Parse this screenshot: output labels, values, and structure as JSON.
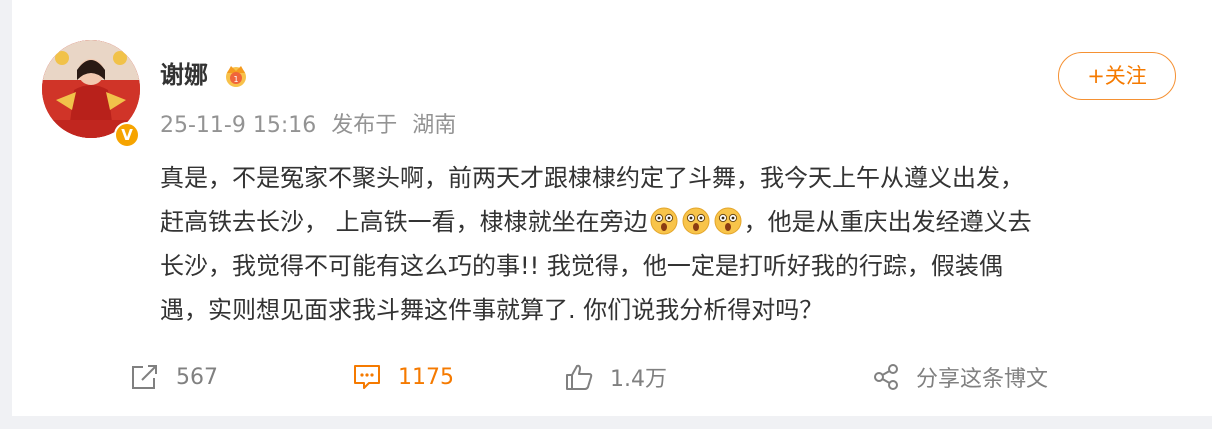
{
  "post": {
    "author": "谢娜",
    "timestamp": "25-11-9 15:16",
    "publish_location_prefix": "发布于",
    "location": "湖南",
    "follow_label": "+关注",
    "content_lines": [
      "真是，不是冤家不聚头啊，前两天才跟棣棣约定了斗舞，我今天上午从遵义出发，",
      "赶高铁去长沙， 上高铁一看，棣棣就坐在旁边",
      "，他是从重庆出发经遵义去",
      "长沙，我觉得不可能有这么巧的事!! 我觉得，他一定是打听好我的行踪，假装偶",
      "遇，实则想见面求我斗舞这件事就算了. 你们说我分析得对吗？"
    ],
    "emoji_icons": [
      "surprised-face-icon",
      "surprised-face-icon",
      "surprised-face-icon"
    ]
  },
  "actions": {
    "repost_count": "567",
    "comment_count": "1175",
    "like_count": "1.4万",
    "share_label": "分享这条博文"
  },
  "colors": {
    "accent": "#f57a00",
    "text": "#333333",
    "muted": "#939393",
    "verified_badge": "#f6a400"
  }
}
